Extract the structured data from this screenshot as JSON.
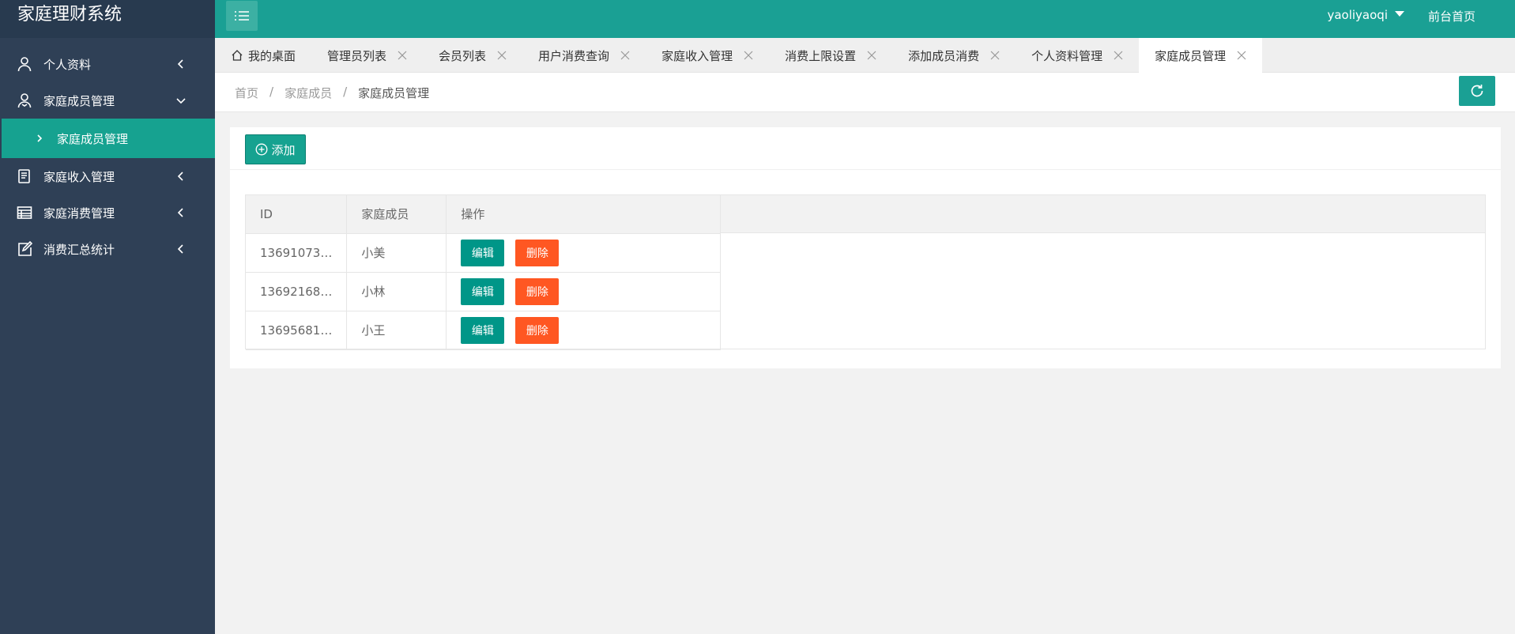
{
  "app": {
    "title": "家庭理财系统"
  },
  "header": {
    "user": "yaoliyaoqi",
    "home_link": "前台首页"
  },
  "sidebar": {
    "items": [
      {
        "label": "个人资料",
        "icon": "user-icon"
      },
      {
        "label": "家庭成员管理",
        "icon": "user-group-icon",
        "expanded": true
      },
      {
        "label": "家庭收入管理",
        "icon": "notebook-icon"
      },
      {
        "label": "家庭消费管理",
        "icon": "table-icon"
      },
      {
        "label": "消费汇总统计",
        "icon": "edit-icon"
      }
    ],
    "sub_item": {
      "label": "家庭成员管理"
    }
  },
  "tabs": [
    {
      "label": "我的桌面"
    },
    {
      "label": "管理员列表"
    },
    {
      "label": "会员列表"
    },
    {
      "label": "用户消费查询"
    },
    {
      "label": "家庭收入管理"
    },
    {
      "label": "消费上限设置"
    },
    {
      "label": "添加成员消费"
    },
    {
      "label": "个人资料管理"
    },
    {
      "label": "家庭成员管理"
    }
  ],
  "breadcrumb": {
    "home": "首页",
    "level1": "家庭成员",
    "current": "家庭成员管理",
    "sep": "/"
  },
  "toolbar": {
    "add_label": "添加"
  },
  "table": {
    "headers": {
      "id": "ID",
      "name": "家庭成员",
      "ops": "操作"
    },
    "rows": [
      {
        "id": "13691073…",
        "name": "小美"
      },
      {
        "id": "13692168…",
        "name": "小林"
      },
      {
        "id": "13695681…",
        "name": "小王"
      }
    ],
    "edit_label": "编辑",
    "delete_label": "删除"
  },
  "colors": {
    "sidebar": "#2f4056",
    "accent": "#1aa094",
    "danger": "#ff5722"
  }
}
